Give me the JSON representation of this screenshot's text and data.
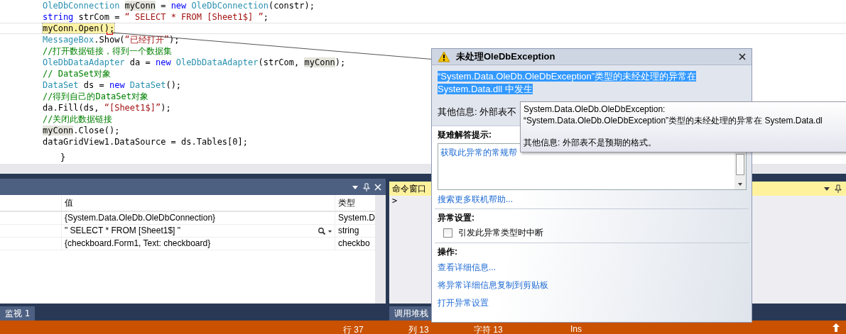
{
  "editor": {
    "lines": [
      {
        "current": false,
        "tokens": [
          {
            "text": "OleDbConnection ",
            "kind": "type"
          },
          {
            "text": "myConn",
            "kind": "ref"
          },
          {
            "text": " = ",
            "kind": "plain"
          },
          {
            "text": "new ",
            "kind": "keyword"
          },
          {
            "text": "OleDbConnection",
            "kind": "type"
          },
          {
            "text": "(constr);",
            "kind": "plain"
          }
        ]
      },
      {
        "current": false,
        "tokens": [
          {
            "text": "string",
            "kind": "keyword"
          },
          {
            "text": " strCom = ",
            "kind": "plain"
          },
          {
            "text": "“ SELECT * FROM [Sheet1$] ”",
            "kind": "string"
          },
          {
            "text": ";",
            "kind": "plain"
          }
        ]
      },
      {
        "current": true,
        "tokens": [
          {
            "text": "myConn.Open();",
            "kind": "plain"
          }
        ]
      },
      {
        "current": false,
        "tokens": [
          {
            "text": "MessageBox",
            "kind": "type"
          },
          {
            "text": ".Show(",
            "kind": "plain"
          },
          {
            "text": "“已经打开”",
            "kind": "string"
          },
          {
            "text": ");",
            "kind": "plain"
          }
        ]
      },
      {
        "current": false,
        "tokens": [
          {
            "text": "//打开数据链接，得到一个数据集",
            "kind": "comment"
          }
        ]
      },
      {
        "current": false,
        "tokens": [
          {
            "text": "OleDbDataAdapter",
            "kind": "type"
          },
          {
            "text": " da = ",
            "kind": "plain"
          },
          {
            "text": "new ",
            "kind": "keyword"
          },
          {
            "text": "OleDbDataAdapter",
            "kind": "type"
          },
          {
            "text": "(strCom, ",
            "kind": "plain"
          },
          {
            "text": "myConn",
            "kind": "ref"
          },
          {
            "text": ");",
            "kind": "plain"
          }
        ]
      },
      {
        "current": false,
        "tokens": [
          {
            "text": "// DataSet对象",
            "kind": "comment"
          }
        ]
      },
      {
        "current": false,
        "tokens": [
          {
            "text": "DataSet",
            "kind": "type"
          },
          {
            "text": " ds = ",
            "kind": "plain"
          },
          {
            "text": "new ",
            "kind": "keyword"
          },
          {
            "text": "DataSet",
            "kind": "type"
          },
          {
            "text": "();",
            "kind": "plain"
          }
        ]
      },
      {
        "current": false,
        "tokens": [
          {
            "text": "//得到自己的DataSet对象",
            "kind": "comment"
          }
        ]
      },
      {
        "current": false,
        "tokens": [
          {
            "text": "da.Fill(ds, ",
            "kind": "plain"
          },
          {
            "text": "“[Sheet1$]”",
            "kind": "string"
          },
          {
            "text": ");",
            "kind": "plain"
          }
        ]
      },
      {
        "current": false,
        "tokens": [
          {
            "text": "//关闭此数据链接",
            "kind": "comment"
          }
        ]
      },
      {
        "current": false,
        "tokens": [
          {
            "text": "myConn",
            "kind": "ref"
          },
          {
            "text": ".Close();",
            "kind": "plain"
          }
        ]
      },
      {
        "current": false,
        "tokens": [
          {
            "text": "dataGridView1.DataSource = ds.Tables[0];",
            "kind": "plain"
          }
        ]
      }
    ],
    "closing_brace": "}"
  },
  "watch_panel": {
    "columns": [
      "值",
      "类型"
    ],
    "rows": [
      {
        "value": "{System.Data.OleDb.OleDbConnection}",
        "type": "System.D",
        "has_visualizer": false
      },
      {
        "value": "\" SELECT * FROM [Sheet1$] \"",
        "type": "string",
        "has_visualizer": true
      },
      {
        "value": "{checkboard.Form1, Text: checkboard}",
        "type": "checkbo",
        "has_visualizer": false
      }
    ],
    "tab": "监视 1"
  },
  "command_window": {
    "title": "命令窗口",
    "prompt": ">",
    "tab": "调用堆栈"
  },
  "status_bar": {
    "line": "行 37",
    "column": "列 13",
    "char": "字符 13",
    "mode": "Ins"
  },
  "exception_dialog": {
    "title": "未处理OleDbException",
    "message_lines": [
      "“System.Data.OleDb.OleDbException”类型的未经处理的异常在",
      "System.Data.dll 中发生"
    ],
    "message_selected": true,
    "other_info": "其他信息: 外部表不",
    "troubleshooting_title": "疑难解答提示:",
    "help_links": [
      "获取此异常的常规帮"
    ],
    "more_help": "搜索更多联机帮助...",
    "settings_title": "异常设置:",
    "checkbox": {
      "label": "引发此异常类型时中断",
      "checked": false
    },
    "actions_title": "操作:",
    "actions": [
      "查看详细信息...",
      "将异常详细信息复制到剪贴板",
      "打开异常设置"
    ]
  },
  "tooltip": {
    "lines": [
      "System.Data.OleDb.OleDbException:",
      "  “System.Data.OleDb.OleDbException”类型的未经处理的异常在 System.Data.dl",
      "其他信息: 外部表不是预期的格式。"
    ]
  }
}
